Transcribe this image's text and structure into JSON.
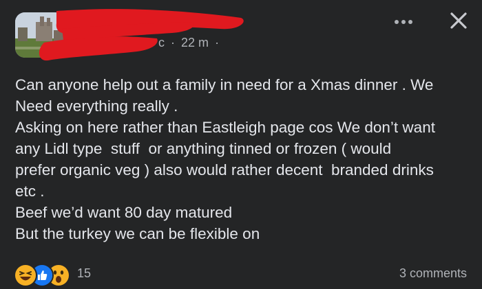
{
  "post": {
    "author_redacted": true,
    "meta": {
      "name_fragment": "c",
      "separator": "·",
      "time": "22 m",
      "trailing_separator": "·"
    },
    "icons": {
      "more": "more-horizontal-icon",
      "close": "close-icon"
    },
    "body_lines": [
      "Can anyone help out a family in need for a Xmas dinner . We",
      "Need everything really .",
      "Asking on here rather than Eastleigh page cos We don’t want",
      "any Lidl type  stuff  or anything tinned or frozen ( would",
      "prefer organic veg ) also would rather decent  branded drinks",
      "etc .",
      "Beef we’d want 80 day matured",
      "But the turkey we can be flexible on"
    ]
  },
  "footer": {
    "reactions": [
      "haha-icon",
      "like-icon",
      "wow-icon"
    ],
    "reaction_count": "15",
    "comments": "3 comments"
  },
  "colors": {
    "background": "#242526",
    "text": "#e4e6eb",
    "secondary_text": "#b0b3b8",
    "redaction": "#e0191f",
    "like_blue": "#1877f2",
    "reaction_yellow": "#f7b125"
  }
}
